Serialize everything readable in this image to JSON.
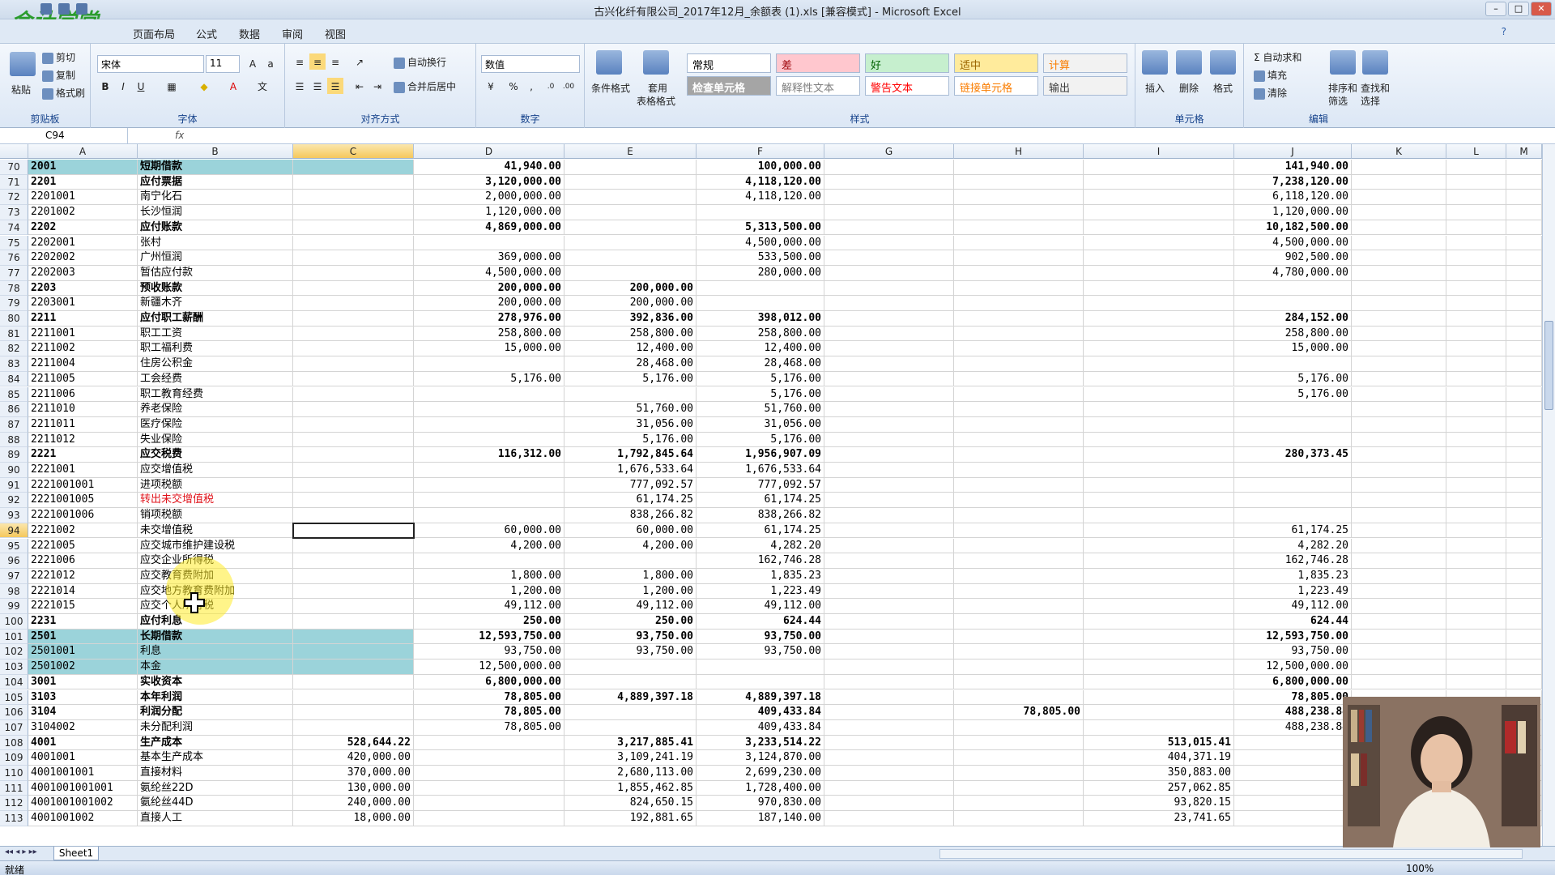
{
  "window": {
    "title": "古兴化纤有限公司_2017年12月_余额表 (1).xls  [兼容模式] - Microsoft Excel",
    "logo_text": "会计学堂"
  },
  "menu": {
    "tabs": [
      "页面布局",
      "公式",
      "数据",
      "审阅",
      "视图"
    ]
  },
  "ribbon": {
    "clipboard": {
      "paste": "粘贴",
      "cut": "剪切",
      "copy": "复制",
      "format_painter": "格式刷",
      "label": "剪贴板"
    },
    "font": {
      "name": "宋体",
      "size": "11",
      "label": "字体"
    },
    "alignment": {
      "wrap": "自动换行",
      "merge": "合并后居中",
      "label": "对齐方式"
    },
    "number": {
      "format": "数值",
      "label": "数字"
    },
    "styles": {
      "cond_format": "条件格式",
      "table_format_1": "套用",
      "table_format_2": "表格格式",
      "label": "样式",
      "cells": [
        {
          "text": "常规",
          "bg": "#ffffff",
          "color": "#000000"
        },
        {
          "text": "差",
          "bg": "#ffc7ce",
          "color": "#9c0006"
        },
        {
          "text": "好",
          "bg": "#c6efce",
          "color": "#006100"
        },
        {
          "text": "适中",
          "bg": "#ffeb9c",
          "color": "#9c6500"
        },
        {
          "text": "计算",
          "bg": "#f2f2f2",
          "color": "#fa7d00"
        },
        {
          "text": "检查单元格",
          "bg": "#a5a5a5",
          "color": "#ffffff"
        },
        {
          "text": "解释性文本",
          "bg": "#ffffff",
          "color": "#7f7f7f"
        },
        {
          "text": "警告文本",
          "bg": "#ffffff",
          "color": "#ff0000"
        },
        {
          "text": "链接单元格",
          "bg": "#ffffff",
          "color": "#fa7d00"
        },
        {
          "text": "输出",
          "bg": "#f2f2f2",
          "color": "#3f3f3f"
        }
      ]
    },
    "cells_group": {
      "insert": "插入",
      "delete": "删除",
      "format": "格式",
      "label": "单元格"
    },
    "editing": {
      "autosum": "自动求和",
      "fill": "填充",
      "clear": "清除",
      "sort_1": "排序和",
      "sort_2": "筛选",
      "find_1": "查找和",
      "find_2": "选择",
      "label": "编辑"
    }
  },
  "formula_bar": {
    "name_box": "C94",
    "fx": "fx",
    "content": ""
  },
  "columns": [
    "A",
    "B",
    "C",
    "D",
    "E",
    "F",
    "G",
    "H",
    "I",
    "J",
    "K",
    "L",
    "M"
  ],
  "selected_cell": {
    "row": 94,
    "col": "C"
  },
  "rows": [
    {
      "r": 70,
      "a": "2001",
      "b": "短期借款",
      "c": "",
      "d": "41,940.00",
      "e": "",
      "f": "100,000.00",
      "g": "",
      "h": "",
      "i": "",
      "j": "141,940.00",
      "bold": true,
      "teal": true
    },
    {
      "r": 71,
      "a": "2201",
      "b": "应付票据",
      "c": "",
      "d": "3,120,000.00",
      "e": "",
      "f": "4,118,120.00",
      "g": "",
      "h": "",
      "i": "",
      "j": "7,238,120.00",
      "bold": true
    },
    {
      "r": 72,
      "a": "2201001",
      "b": "南宁化石",
      "c": "",
      "d": "2,000,000.00",
      "e": "",
      "f": "4,118,120.00",
      "g": "",
      "h": "",
      "i": "",
      "j": "6,118,120.00"
    },
    {
      "r": 73,
      "a": "2201002",
      "b": "长沙恒润",
      "c": "",
      "d": "1,120,000.00",
      "e": "",
      "f": "",
      "g": "",
      "h": "",
      "i": "",
      "j": "1,120,000.00"
    },
    {
      "r": 74,
      "a": "2202",
      "b": "应付账款",
      "c": "",
      "d": "4,869,000.00",
      "e": "",
      "f": "5,313,500.00",
      "g": "",
      "h": "",
      "i": "",
      "j": "10,182,500.00",
      "bold": true
    },
    {
      "r": 75,
      "a": "2202001",
      "b": "张村",
      "c": "",
      "d": "",
      "e": "",
      "f": "4,500,000.00",
      "g": "",
      "h": "",
      "i": "",
      "j": "4,500,000.00"
    },
    {
      "r": 76,
      "a": "2202002",
      "b": "广州恒润",
      "c": "",
      "d": "369,000.00",
      "e": "",
      "f": "533,500.00",
      "g": "",
      "h": "",
      "i": "",
      "j": "902,500.00"
    },
    {
      "r": 77,
      "a": "2202003",
      "b": "暂估应付款",
      "c": "",
      "d": "4,500,000.00",
      "e": "",
      "f": "280,000.00",
      "g": "",
      "h": "",
      "i": "",
      "j": "4,780,000.00"
    },
    {
      "r": 78,
      "a": "2203",
      "b": "预收账款",
      "c": "",
      "d": "200,000.00",
      "e": "200,000.00",
      "f": "",
      "g": "",
      "h": "",
      "i": "",
      "j": "",
      "bold": true
    },
    {
      "r": 79,
      "a": "2203001",
      "b": "新疆木齐",
      "c": "",
      "d": "200,000.00",
      "e": "200,000.00",
      "f": "",
      "g": "",
      "h": "",
      "i": "",
      "j": ""
    },
    {
      "r": 80,
      "a": "2211",
      "b": "应付职工薪酬",
      "c": "",
      "d": "278,976.00",
      "e": "392,836.00",
      "f": "398,012.00",
      "g": "",
      "h": "",
      "i": "",
      "j": "284,152.00",
      "bold": true
    },
    {
      "r": 81,
      "a": "2211001",
      "b": "职工工资",
      "c": "",
      "d": "258,800.00",
      "e": "258,800.00",
      "f": "258,800.00",
      "g": "",
      "h": "",
      "i": "",
      "j": "258,800.00"
    },
    {
      "r": 82,
      "a": "2211002",
      "b": "职工福利费",
      "c": "",
      "d": "15,000.00",
      "e": "12,400.00",
      "f": "12,400.00",
      "g": "",
      "h": "",
      "i": "",
      "j": "15,000.00"
    },
    {
      "r": 83,
      "a": "2211004",
      "b": "住房公积金",
      "c": "",
      "d": "",
      "e": "28,468.00",
      "f": "28,468.00",
      "g": "",
      "h": "",
      "i": "",
      "j": ""
    },
    {
      "r": 84,
      "a": "2211005",
      "b": "工会经费",
      "c": "",
      "d": "5,176.00",
      "e": "5,176.00",
      "f": "5,176.00",
      "g": "",
      "h": "",
      "i": "",
      "j": "5,176.00"
    },
    {
      "r": 85,
      "a": "2211006",
      "b": "职工教育经费",
      "c": "",
      "d": "",
      "e": "",
      "f": "5,176.00",
      "g": "",
      "h": "",
      "i": "",
      "j": "5,176.00"
    },
    {
      "r": 86,
      "a": "2211010",
      "b": "养老保险",
      "c": "",
      "d": "",
      "e": "51,760.00",
      "f": "51,760.00",
      "g": "",
      "h": "",
      "i": "",
      "j": ""
    },
    {
      "r": 87,
      "a": "2211011",
      "b": "医疗保险",
      "c": "",
      "d": "",
      "e": "31,056.00",
      "f": "31,056.00",
      "g": "",
      "h": "",
      "i": "",
      "j": ""
    },
    {
      "r": 88,
      "a": "2211012",
      "b": "失业保险",
      "c": "",
      "d": "",
      "e": "5,176.00",
      "f": "5,176.00",
      "g": "",
      "h": "",
      "i": "",
      "j": ""
    },
    {
      "r": 89,
      "a": "2221",
      "b": "应交税费",
      "c": "",
      "d": "116,312.00",
      "e": "1,792,845.64",
      "f": "1,956,907.09",
      "g": "",
      "h": "",
      "i": "",
      "j": "280,373.45",
      "bold": true
    },
    {
      "r": 90,
      "a": "2221001",
      "b": "应交增值税",
      "c": "",
      "d": "",
      "e": "1,676,533.64",
      "f": "1,676,533.64",
      "g": "",
      "h": "",
      "i": "",
      "j": ""
    },
    {
      "r": 91,
      "a": "2221001001",
      "b": "进项税额",
      "c": "",
      "d": "",
      "e": "777,092.57",
      "f": "777,092.57",
      "g": "",
      "h": "",
      "i": "",
      "j": ""
    },
    {
      "r": 92,
      "a": "2221001005",
      "b": "转出未交增值税",
      "c": "",
      "d": "",
      "e": "61,174.25",
      "f": "61,174.25",
      "g": "",
      "h": "",
      "i": "",
      "j": "",
      "red_b": true
    },
    {
      "r": 93,
      "a": "2221001006",
      "b": "销项税额",
      "c": "",
      "d": "",
      "e": "838,266.82",
      "f": "838,266.82",
      "g": "",
      "h": "",
      "i": "",
      "j": ""
    },
    {
      "r": 94,
      "a": "2221002",
      "b": "未交增值税",
      "c": "",
      "d": "60,000.00",
      "e": "60,000.00",
      "f": "61,174.25",
      "g": "",
      "h": "",
      "i": "",
      "j": "61,174.25"
    },
    {
      "r": 95,
      "a": "2221005",
      "b": "应交城市维护建设税",
      "c": "",
      "d": "4,200.00",
      "e": "4,200.00",
      "f": "4,282.20",
      "g": "",
      "h": "",
      "i": "",
      "j": "4,282.20"
    },
    {
      "r": 96,
      "a": "2221006",
      "b": "应交企业所得税",
      "c": "",
      "d": "",
      "e": "",
      "f": "162,746.28",
      "g": "",
      "h": "",
      "i": "",
      "j": "162,746.28"
    },
    {
      "r": 97,
      "a": "2221012",
      "b": "应交教育费附加",
      "c": "",
      "d": "1,800.00",
      "e": "1,800.00",
      "f": "1,835.23",
      "g": "",
      "h": "",
      "i": "",
      "j": "1,835.23"
    },
    {
      "r": 98,
      "a": "2221014",
      "b": "应交地方教育费附加",
      "c": "",
      "d": "1,200.00",
      "e": "1,200.00",
      "f": "1,223.49",
      "g": "",
      "h": "",
      "i": "",
      "j": "1,223.49"
    },
    {
      "r": 99,
      "a": "2221015",
      "b": "应交个人所得税",
      "c": "",
      "d": "49,112.00",
      "e": "49,112.00",
      "f": "49,112.00",
      "g": "",
      "h": "",
      "i": "",
      "j": "49,112.00"
    },
    {
      "r": 100,
      "a": "2231",
      "b": "应付利息",
      "c": "",
      "d": "250.00",
      "e": "250.00",
      "f": "624.44",
      "g": "",
      "h": "",
      "i": "",
      "j": "624.44",
      "bold": true
    },
    {
      "r": 101,
      "a": "2501",
      "b": "长期借款",
      "c": "",
      "d": "12,593,750.00",
      "e": "93,750.00",
      "f": "93,750.00",
      "g": "",
      "h": "",
      "i": "",
      "j": "12,593,750.00",
      "bold": true,
      "teal": true
    },
    {
      "r": 102,
      "a": "2501001",
      "b": "利息",
      "c": "",
      "d": "93,750.00",
      "e": "93,750.00",
      "f": "93,750.00",
      "g": "",
      "h": "",
      "i": "",
      "j": "93,750.00",
      "teal": true
    },
    {
      "r": 103,
      "a": "2501002",
      "b": "本金",
      "c": "",
      "d": "12,500,000.00",
      "e": "",
      "f": "",
      "g": "",
      "h": "",
      "i": "",
      "j": "12,500,000.00",
      "teal": true
    },
    {
      "r": 104,
      "a": "3001",
      "b": "实收资本",
      "c": "",
      "d": "6,800,000.00",
      "e": "",
      "f": "",
      "g": "",
      "h": "",
      "i": "",
      "j": "6,800,000.00",
      "bold": true
    },
    {
      "r": 105,
      "a": "3103",
      "b": "本年利润",
      "c": "",
      "d": "78,805.00",
      "e": "4,889,397.18",
      "f": "4,889,397.18",
      "g": "",
      "h": "",
      "i": "",
      "j": "78,805.00",
      "bold": true
    },
    {
      "r": 106,
      "a": "3104",
      "b": "利润分配",
      "c": "",
      "d": "78,805.00",
      "e": "",
      "f": "409,433.84",
      "g": "",
      "h": "78,805.00",
      "i": "",
      "j": "488,238.84",
      "bold": true
    },
    {
      "r": 107,
      "a": "3104002",
      "b": "未分配利润",
      "c": "",
      "d": "78,805.00",
      "e": "",
      "f": "409,433.84",
      "g": "",
      "h": "",
      "i": "",
      "j": "488,238.84"
    },
    {
      "r": 108,
      "a": "4001",
      "b": "生产成本",
      "c": "528,644.22",
      "d": "",
      "e": "3,217,885.41",
      "f": "3,233,514.22",
      "g": "",
      "h": "",
      "i": "513,015.41",
      "j": "",
      "bold": true
    },
    {
      "r": 109,
      "a": "4001001",
      "b": "基本生产成本",
      "c": "420,000.00",
      "d": "",
      "e": "3,109,241.19",
      "f": "3,124,870.00",
      "g": "",
      "h": "",
      "i": "404,371.19",
      "j": ""
    },
    {
      "r": 110,
      "a": "4001001001",
      "b": "直接材料",
      "c": "370,000.00",
      "d": "",
      "e": "2,680,113.00",
      "f": "2,699,230.00",
      "g": "",
      "h": "",
      "i": "350,883.00",
      "j": ""
    },
    {
      "r": 111,
      "a": "4001001001001",
      "b": "氨纶丝22D",
      "c": "130,000.00",
      "d": "",
      "e": "1,855,462.85",
      "f": "1,728,400.00",
      "g": "",
      "h": "",
      "i": "257,062.85",
      "j": ""
    },
    {
      "r": 112,
      "a": "4001001001002",
      "b": "氨纶丝44D",
      "c": "240,000.00",
      "d": "",
      "e": "824,650.15",
      "f": "970,830.00",
      "g": "",
      "h": "",
      "i": "93,820.15",
      "j": ""
    },
    {
      "r": 113,
      "a": "4001001002",
      "b": "直接人工",
      "c": "18,000.00",
      "d": "",
      "e": "192,881.65",
      "f": "187,140.00",
      "g": "",
      "h": "",
      "i": "23,741.65",
      "j": ""
    }
  ],
  "sheet_tab": "Sheet1",
  "status": {
    "ready": "就绪",
    "zoom": "100%"
  }
}
